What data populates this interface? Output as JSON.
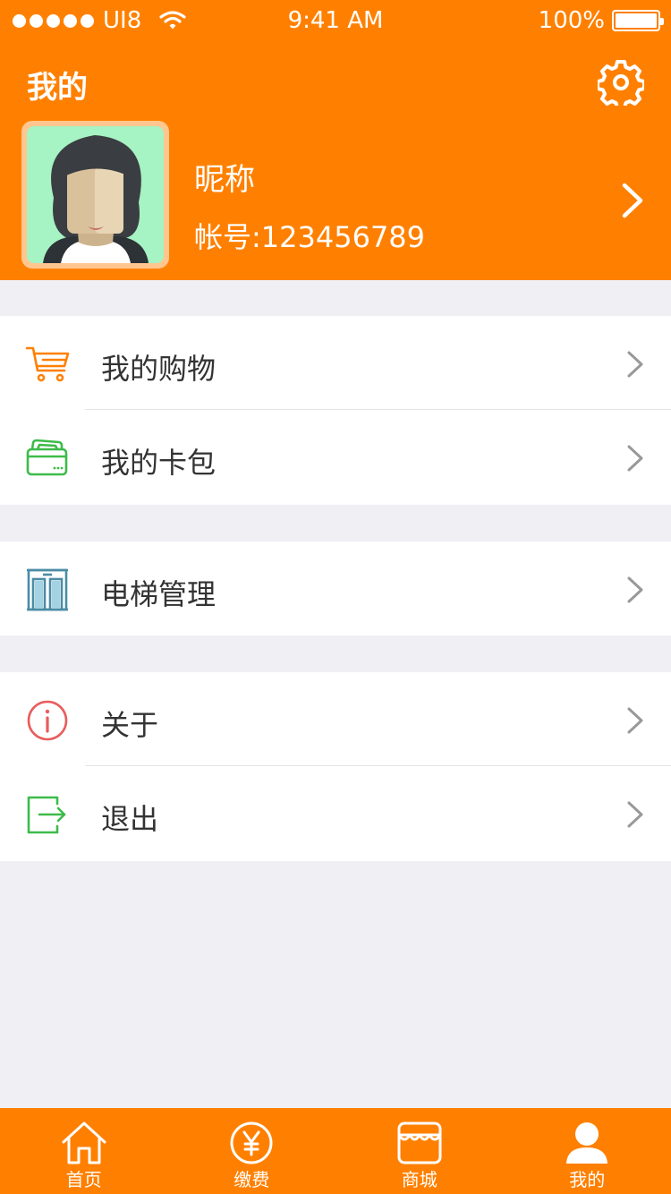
{
  "status_bar": {
    "carrier": "UI8",
    "time": "9:41 AM",
    "battery": "100%"
  },
  "header": {
    "title": "我的",
    "nickname": "昵称",
    "account": "帐号:123456789"
  },
  "menu": {
    "shopping": "我的购物",
    "card_wallet": "我的卡包",
    "elevator": "电梯管理",
    "about": "关于",
    "logout": "退出"
  },
  "tabbar": {
    "home": "首页",
    "pay": "缴费",
    "mall": "商城",
    "mine": "我的"
  },
  "colors": {
    "brand": "#ff8000",
    "cart_icon": "#ff8000",
    "wallet_icon": "#3dbb4a",
    "elevator_icon": "#4a8ca6",
    "about_icon": "#e85c5c",
    "logout_icon": "#3dbb4a"
  },
  "icons": {
    "settings": "gear-icon",
    "profile_arrow": "chevron-right-icon",
    "shopping": "cart-icon",
    "card_wallet": "wallet-icon",
    "elevator": "elevator-icon",
    "about": "info-icon",
    "logout": "logout-icon",
    "tab_home": "home-icon",
    "tab_pay": "yen-icon",
    "tab_mall": "store-icon",
    "tab_mine": "user-icon"
  }
}
